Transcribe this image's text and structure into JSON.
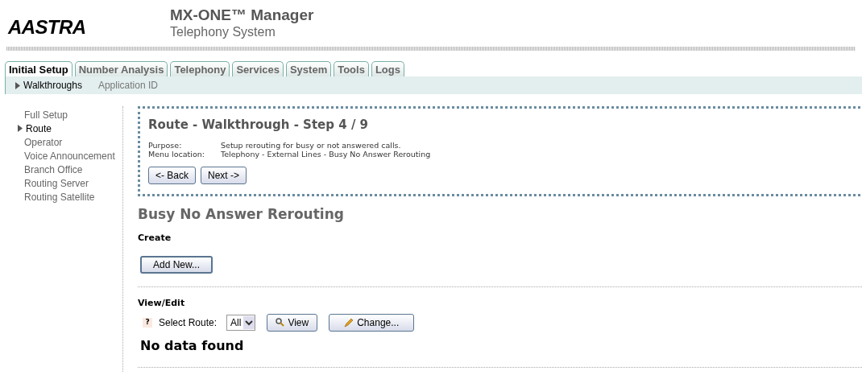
{
  "header": {
    "logo": "AASTRA",
    "title": "MX-ONE™ Manager",
    "subtitle": "Telephony System"
  },
  "tabs": [
    {
      "label": "Initial Setup",
      "selected": true
    },
    {
      "label": "Number Analysis",
      "selected": false
    },
    {
      "label": "Telephony",
      "selected": false
    },
    {
      "label": "Services",
      "selected": false
    },
    {
      "label": "System",
      "selected": false
    },
    {
      "label": "Tools",
      "selected": false
    },
    {
      "label": "Logs",
      "selected": false
    }
  ],
  "subtabs": [
    {
      "label": "Walkthroughs",
      "selected": true
    },
    {
      "label": "Application ID",
      "selected": false
    }
  ],
  "sidebar": {
    "items": [
      {
        "label": "Full Setup",
        "selected": false
      },
      {
        "label": "Route",
        "selected": true
      },
      {
        "label": "Operator",
        "selected": false
      },
      {
        "label": "Voice Announcement",
        "selected": false
      },
      {
        "label": "Branch Office",
        "selected": false
      },
      {
        "label": "Routing Server",
        "selected": false
      },
      {
        "label": "Routing Satellite",
        "selected": false
      }
    ]
  },
  "walkthrough": {
    "title": "Route - Walkthrough - Step 4 / 9",
    "info": [
      {
        "label": "Purpose:",
        "value": "Setup rerouting for busy or not answered calls."
      },
      {
        "label": "Menu location:",
        "value": "Telephony - External Lines - Busy No Answer Rerouting"
      }
    ],
    "buttons": [
      "<- Back",
      "Next ->"
    ]
  },
  "page_title": "Busy No Answer Rerouting",
  "create": {
    "heading": "Create",
    "button": "Add New..."
  },
  "view_edit": {
    "heading": "View/Edit",
    "help": "?",
    "select_label": "Select Route:",
    "select_value": "All",
    "view_button": "View",
    "change_button": "Change...",
    "empty": "No data found"
  }
}
